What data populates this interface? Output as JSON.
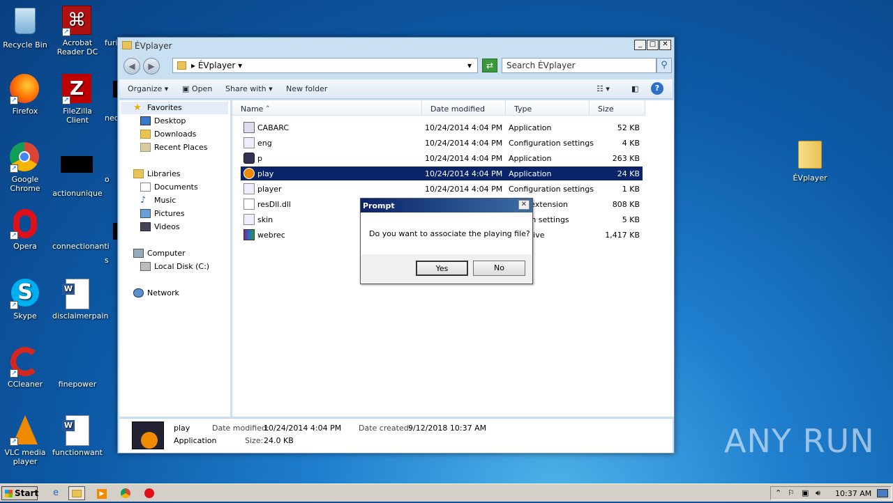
{
  "desktop": {
    "icons": [
      {
        "label": "Recycle Bin"
      },
      {
        "label": "Acrobat Reader DC"
      },
      {
        "label": "furi"
      },
      {
        "label": "Firefox"
      },
      {
        "label": "FileZilla Client"
      },
      {
        "label": "neo"
      },
      {
        "label": "Google Chrome"
      },
      {
        "label": "actionunique"
      },
      {
        "label": "o"
      },
      {
        "label": "Opera"
      },
      {
        "label": "connectionanti"
      },
      {
        "label": "s"
      },
      {
        "label": "Skype"
      },
      {
        "label": "disclaimerpain"
      },
      {
        "label": "CCleaner"
      },
      {
        "label": "finepower"
      },
      {
        "label": "VLC media player"
      },
      {
        "label": "functionwant"
      },
      {
        "label": "ÉVplayer"
      }
    ]
  },
  "window": {
    "title": "ÉVplayer",
    "address_path": "ÉVplayer",
    "search_placeholder": "Search ÉVplayer",
    "toolbar": {
      "organize": "Organize",
      "open": "Open",
      "share_with": "Share with",
      "new_folder": "New folder"
    },
    "nav": {
      "favorites": "Favorites",
      "desktop": "Desktop",
      "downloads": "Downloads",
      "recent_places": "Recent Places",
      "libraries": "Libraries",
      "documents": "Documents",
      "music": "Music",
      "pictures": "Pictures",
      "videos": "Videos",
      "computer": "Computer",
      "local_disk": "Local Disk (C:)",
      "network": "Network"
    },
    "columns": {
      "name": "Name",
      "date": "Date modified",
      "type": "Type",
      "size": "Size"
    },
    "files": [
      {
        "name": "CABARC",
        "date": "10/24/2014 4:04 PM",
        "type": "Application",
        "size": "52 KB"
      },
      {
        "name": "eng",
        "date": "10/24/2014 4:04 PM",
        "type": "Configuration settings",
        "size": "4 KB"
      },
      {
        "name": "p",
        "date": "10/24/2014 4:04 PM",
        "type": "Application",
        "size": "263 KB"
      },
      {
        "name": "play",
        "date": "10/24/2014 4:04 PM",
        "type": "Application",
        "size": "24 KB"
      },
      {
        "name": "player",
        "date": "10/24/2014 4:04 PM",
        "type": "Configuration settings",
        "size": "1 KB"
      },
      {
        "name": "resDll.dll",
        "date": "",
        "type": "ation extension",
        "size": "808 KB"
      },
      {
        "name": "skin",
        "date": "",
        "type": "uration settings",
        "size": "5 KB"
      },
      {
        "name": "webrec",
        "date": "",
        "type": "R archive",
        "size": "1,417 KB"
      }
    ],
    "details": {
      "name": "play",
      "kind": "Application",
      "date_modified_label": "Date modified:",
      "date_modified": "10/24/2014 4:04 PM",
      "date_created_label": "Date created:",
      "date_created": "9/12/2018 10:37 AM",
      "size_label": "Size:",
      "size": "24.0 KB"
    }
  },
  "dialog": {
    "title": "Prompt",
    "message": "Do you want to associate the playing file?",
    "yes": "Yes",
    "no": "No"
  },
  "taskbar": {
    "start": "Start",
    "clock": "10:37 AM"
  },
  "watermark": "ANY RUN"
}
